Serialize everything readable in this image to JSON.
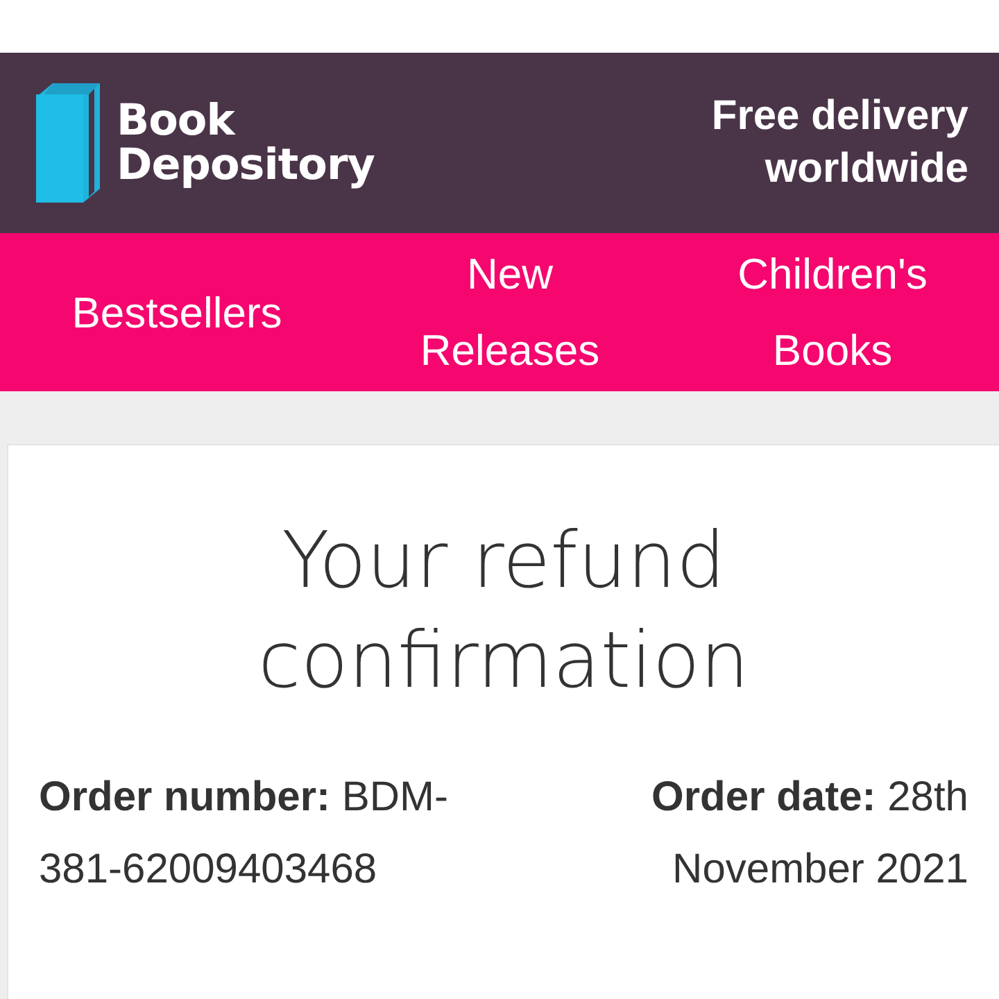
{
  "header": {
    "logo_lines": [
      "Book",
      "Depository"
    ],
    "tagline": "Free delivery worldwide"
  },
  "nav": [
    "Bestsellers",
    "New Releases",
    "Children's Books"
  ],
  "card": {
    "title": "Your refund confirmation",
    "order_number": "**Order number:** BDM-381-62009403468",
    "order_date": "**Order date:** 28th November 2021"
  }
}
